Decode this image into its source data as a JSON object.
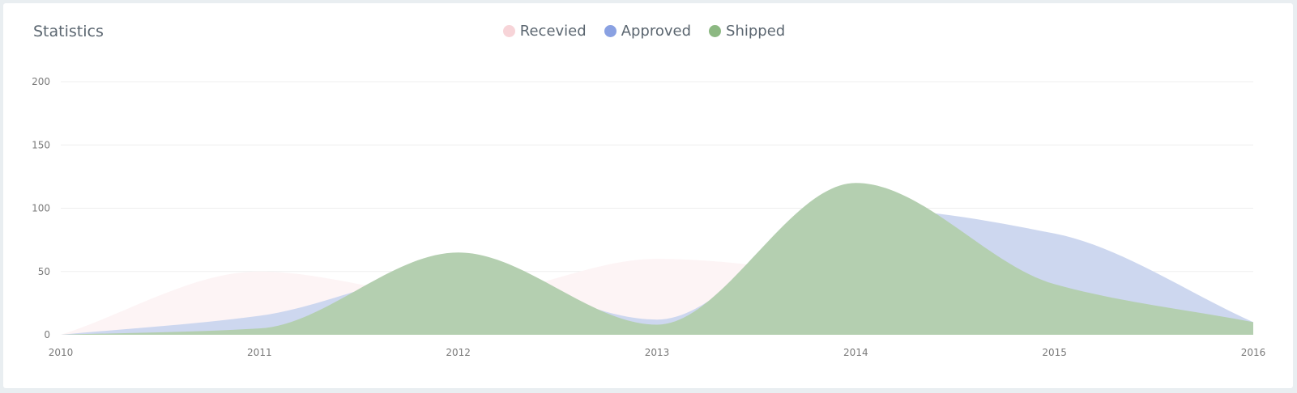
{
  "card": {
    "title": "Statistics"
  },
  "chart_data": {
    "type": "area",
    "title": "",
    "xlabel": "",
    "ylabel": "",
    "x": [
      "2010",
      "2011",
      "2012",
      "2013",
      "2014",
      "2015",
      "2016"
    ],
    "ylim": [
      0,
      200
    ],
    "yticks": [
      0,
      50,
      100,
      150,
      200
    ],
    "grid": true,
    "legend_position": "top-center",
    "series": [
      {
        "name": "Recevied",
        "color": "#f7d4d8",
        "fill": "#fdf4f5",
        "values": [
          0,
          50,
          30,
          60,
          45,
          20,
          10
        ]
      },
      {
        "name": "Approved",
        "color": "#8aa1e2",
        "fill": "#cdd7ef",
        "values": [
          0,
          15,
          50,
          12,
          100,
          80,
          10
        ]
      },
      {
        "name": "Shipped",
        "color": "#8cb882",
        "fill": "#b4cfb0",
        "values": [
          0,
          5,
          65,
          8,
          120,
          40,
          10
        ]
      }
    ]
  }
}
